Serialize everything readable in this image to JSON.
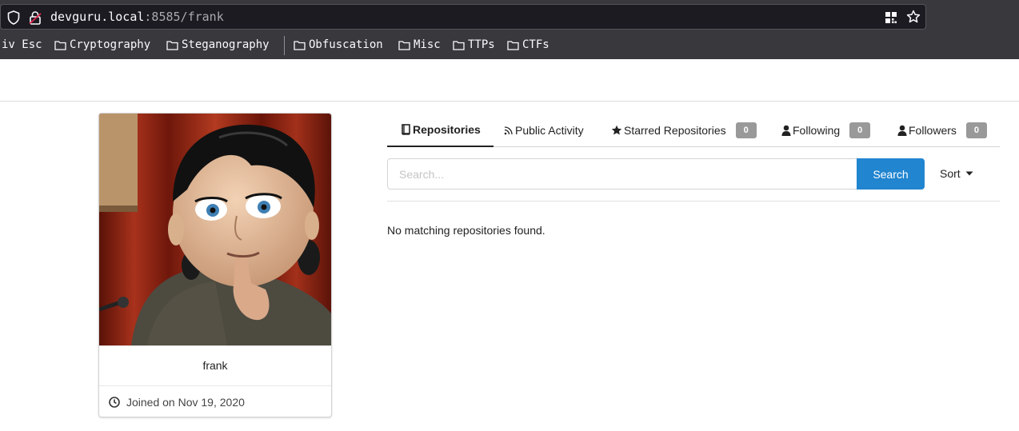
{
  "browser": {
    "url_host": "devguru.local",
    "url_rest": ":8585/frank",
    "bookmarks": [
      {
        "label": "iv Esc",
        "icon": null
      },
      {
        "label": "Cryptography",
        "icon": "folder-icon"
      },
      {
        "label": "Steganography",
        "icon": "folder-icon"
      },
      {
        "label": "Obfuscation",
        "icon": "folder-icon"
      },
      {
        "label": "Misc",
        "icon": "folder-icon"
      },
      {
        "label": "TTPs",
        "icon": "folder-icon"
      },
      {
        "label": "CTFs",
        "icon": "folder-icon"
      }
    ]
  },
  "profile": {
    "username": "frank",
    "joined": "Joined on Nov 19, 2020"
  },
  "tabs": [
    {
      "label": "Repositories",
      "icon": "book-icon",
      "active": true
    },
    {
      "label": "Public Activity",
      "icon": "rss-icon"
    },
    {
      "label": "Starred Repositories",
      "icon": "star-icon",
      "count": "0"
    },
    {
      "label": "Following",
      "icon": "user-icon",
      "count": "0"
    },
    {
      "label": "Followers",
      "icon": "user-icon",
      "count": "0"
    }
  ],
  "search": {
    "placeholder": "Search...",
    "button_label": "Search",
    "sort_label": "Sort"
  },
  "empty_message": "No matching repositories found.",
  "colors": {
    "accent": "#2185d0",
    "badge": "#999999",
    "chrome_bg": "#38383d"
  }
}
